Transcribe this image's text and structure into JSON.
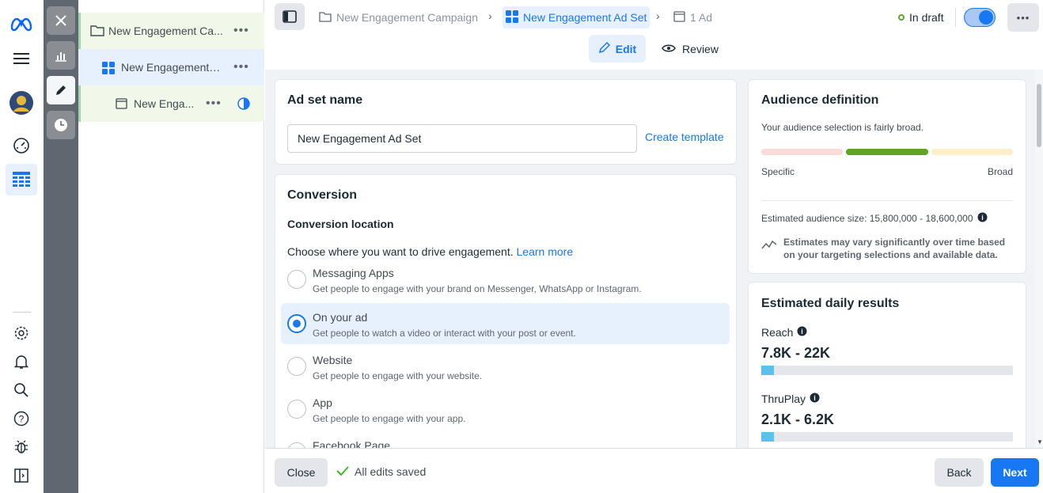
{
  "tree": {
    "campaign": "New Engagement Ca...",
    "adset": "New Engagement ...",
    "ad": "New Enga...",
    "more": "•••"
  },
  "header": {
    "crumb_campaign": "New Engagement Campaign",
    "crumb_adset": "New Engagement Ad Set",
    "crumb_ad": "1 Ad",
    "status": "In draft",
    "edit_tab": "Edit",
    "review_tab": "Review",
    "more": "•••"
  },
  "adset_card": {
    "title": "Ad set name",
    "name_value": "New Engagement Ad Set",
    "create_template": "Create template"
  },
  "conversion": {
    "title": "Conversion",
    "location_label": "Conversion location",
    "prompt": "Choose where you want to drive engagement.",
    "learn_more": "Learn more",
    "options": [
      {
        "title": "Messaging Apps",
        "sub": "Get people to engage with your brand on Messenger, WhatsApp or Instagram.",
        "selected": false
      },
      {
        "title": "On your ad",
        "sub": "Get people to watch a video or interact with your post or event.",
        "selected": true
      },
      {
        "title": "Website",
        "sub": "Get people to engage with your website.",
        "selected": false
      },
      {
        "title": "App",
        "sub": "Get people to engage with your app.",
        "selected": false
      },
      {
        "title": "Facebook Page",
        "sub": "",
        "selected": false
      }
    ]
  },
  "audience": {
    "title": "Audience definition",
    "summary": "Your audience selection is fairly broad.",
    "specific": "Specific",
    "broad": "Broad",
    "size": "Estimated audience size: 15,800,000 - 18,600,000",
    "note": "Estimates may vary significantly over time based on your targeting selections and available data."
  },
  "daily": {
    "title": "Estimated daily results",
    "reach_label": "Reach",
    "reach_value": "7.8K - 22K",
    "reach_fill": 0.05,
    "thruplay_label": "ThruPlay",
    "thruplay_value": "2.1K - 6.2K",
    "thruplay_fill": 0.05
  },
  "footer": {
    "close": "Close",
    "saved": "All edits saved",
    "back": "Back",
    "next": "Next"
  },
  "colors": {
    "accent": "#1877f2",
    "draft": "#5fa536",
    "meter_selected": "#5fa524",
    "meter_specific": "#fadbd8",
    "meter_broad": "#fdf0c8"
  }
}
